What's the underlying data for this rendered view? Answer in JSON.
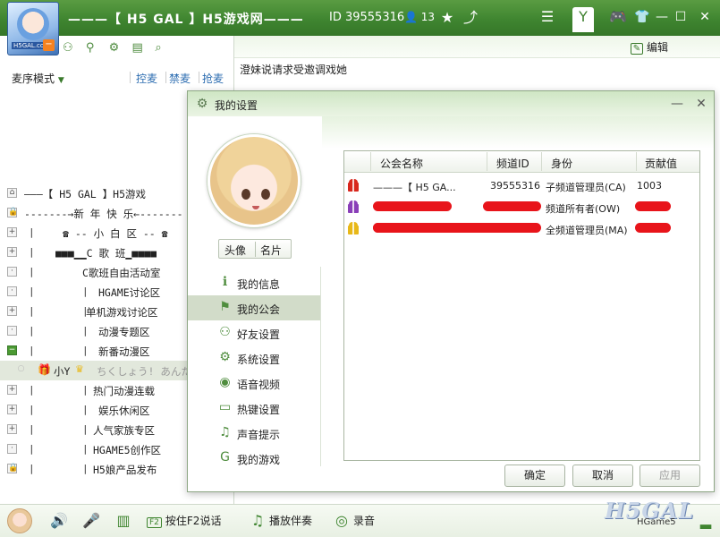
{
  "app": {
    "channel_title": "———【 H5 GAL 】H5游戏网———",
    "channel_id": "ID 39555316",
    "online_count": "13",
    "edit_label": "编辑",
    "logo_tag": "H5GAL.com",
    "main_message": "澄妹说请求受邀调戏她"
  },
  "left_panel": {
    "mode_label": "麦序模式",
    "links": [
      "控麦",
      "禁麦",
      "抢麦"
    ],
    "tree": [
      {
        "box": "home",
        "label": "———【 H5 GAL 】H5游戏",
        "indent": 27
      },
      {
        "box": "lock",
        "label": "-------→新 年 快 乐←-------",
        "indent": 27
      },
      {
        "box": "plus",
        "label": "☎ -- 小 白 区 -- ☎",
        "indent": 70
      },
      {
        "box": "plus",
        "label": "■■■▁▁C 歌 班▁■■■■",
        "indent": 62
      },
      {
        "box": "dot",
        "label": "C歌班自由活动室",
        "indent": 92
      },
      {
        "box": "dot",
        "label": "HGAME讨论区",
        "indent": 110
      },
      {
        "box": "plus",
        "label": "单机游戏讨论区",
        "indent": 96
      },
      {
        "box": "dot",
        "label": "动漫专题区",
        "indent": 110
      },
      {
        "box": "minus",
        "label": "新番动漫区",
        "indent": 110
      },
      {
        "box": "user",
        "label": "小Y",
        "note": "ちくしょう! あんた",
        "indent": 60
      },
      {
        "box": "plus",
        "label": "热门动漫连载",
        "indent": 104
      },
      {
        "box": "plus",
        "label": "娱乐休闲区",
        "indent": 110
      },
      {
        "box": "plus",
        "label": "人气家族专区",
        "indent": 104
      },
      {
        "box": "dot",
        "label": "HGAME5创作区",
        "indent": 104
      },
      {
        "box": "lock",
        "label": "H5娘产品发布",
        "indent": 104
      }
    ]
  },
  "bottom_bar": {
    "ptt_key": "F2",
    "ptt_label": "按住F2说话",
    "music_label": "播放伴奏",
    "record_label": "录音",
    "brand": "H5GAL",
    "brand_sub": "HGame5"
  },
  "dialog": {
    "title": "我的设置",
    "avatar_label": "头像",
    "card_label": "名片",
    "menu": [
      {
        "icon": "info-icon",
        "label": "我的信息"
      },
      {
        "icon": "flag-icon",
        "label": "我的公会"
      },
      {
        "icon": "friends-icon",
        "label": "好友设置"
      },
      {
        "icon": "gear-icon",
        "label": "系统设置"
      },
      {
        "icon": "webcam-icon",
        "label": "语音视频"
      },
      {
        "icon": "keyboard-icon",
        "label": "热键设置"
      },
      {
        "icon": "music-note-icon",
        "label": "声音提示"
      },
      {
        "icon": "game-icon",
        "label": "我的游戏"
      }
    ],
    "active_menu": 1,
    "table": {
      "headers": [
        "公会名称",
        "频道ID",
        "身份",
        "贡献值"
      ],
      "rows": [
        {
          "icon_color": "#d8271d",
          "name": "———【 H5 GA...",
          "id": "39555316",
          "role": "子频道管理员(CA)",
          "contribution": "1003",
          "redacted": false
        },
        {
          "icon_color": "#8a3fb8",
          "name": "",
          "id": "",
          "role": "频道所有者(OW)",
          "contribution": "",
          "redacted": true
        },
        {
          "icon_color": "#e8b818",
          "name": "",
          "id": "",
          "role": "全频道管理员(MA)",
          "contribution": "",
          "redacted": true
        }
      ]
    },
    "buttons": {
      "ok": "确定",
      "cancel": "取消",
      "apply": "应用"
    }
  }
}
